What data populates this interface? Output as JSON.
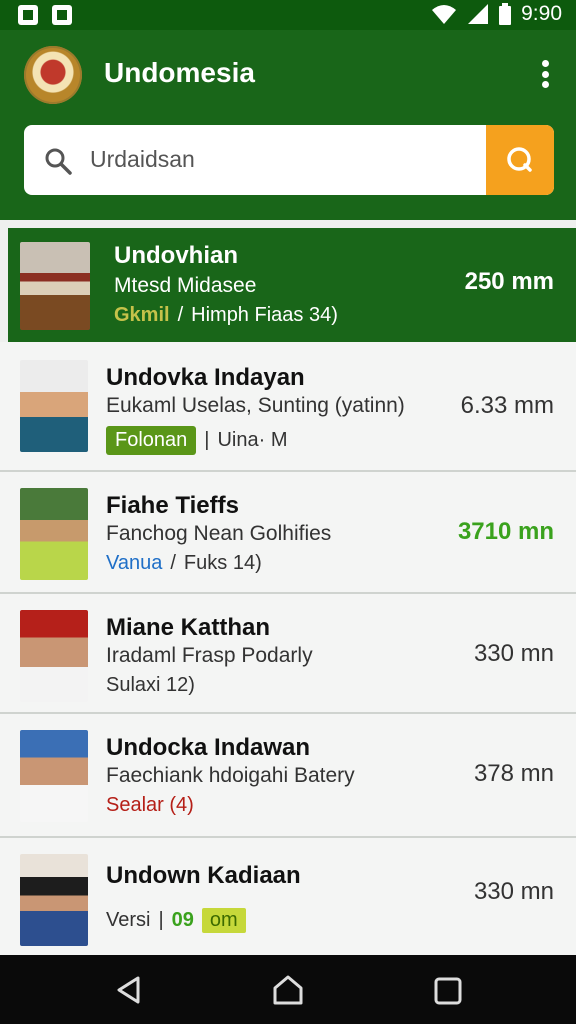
{
  "status": {
    "time": "9:90"
  },
  "app": {
    "title": "Undomesia"
  },
  "search": {
    "query": "Urdaidsan"
  },
  "list": [
    {
      "name": "Undovhian",
      "sub": "Mtesd Midasee",
      "meta_a": "Gkmil",
      "meta_sep": "/",
      "meta_b": "Himph Fiaas 34)",
      "dist": "250 mm",
      "active": true
    },
    {
      "name": "Undovka Indayan",
      "sub": "Eukaml Uselas, Sunting (yatinn)",
      "meta_a": "Folonan",
      "meta_sep": "|",
      "meta_b": "Uina· M",
      "dist": "6.33 mm"
    },
    {
      "name": "Fiahe Tieffs",
      "sub": "Fanchog Nean Golhifies",
      "meta_a": "Vanua",
      "meta_sep": "/",
      "meta_b": "Fuks 14)",
      "dist": "3710 mn"
    },
    {
      "name": "Miane Katthan",
      "sub": "Iradaml Frasp Podarly",
      "meta_a": "Sulaxi 12)",
      "dist": "330 mn"
    },
    {
      "name": "Undocka Indawan",
      "sub": "Faechiank hdoigahi Batery",
      "meta_a": "Sealar (4)",
      "dist": "378 mn"
    },
    {
      "name": "Undown Kadiaan",
      "meta_a": "Versi",
      "meta_sep": "|",
      "meta_b": "09",
      "meta_c": "om",
      "dist": "330 mn"
    }
  ],
  "icons": {
    "search": "search-icon",
    "menu": "more-vert-icon",
    "back": "back-icon",
    "home": "home-icon",
    "recents": "recents-icon"
  }
}
